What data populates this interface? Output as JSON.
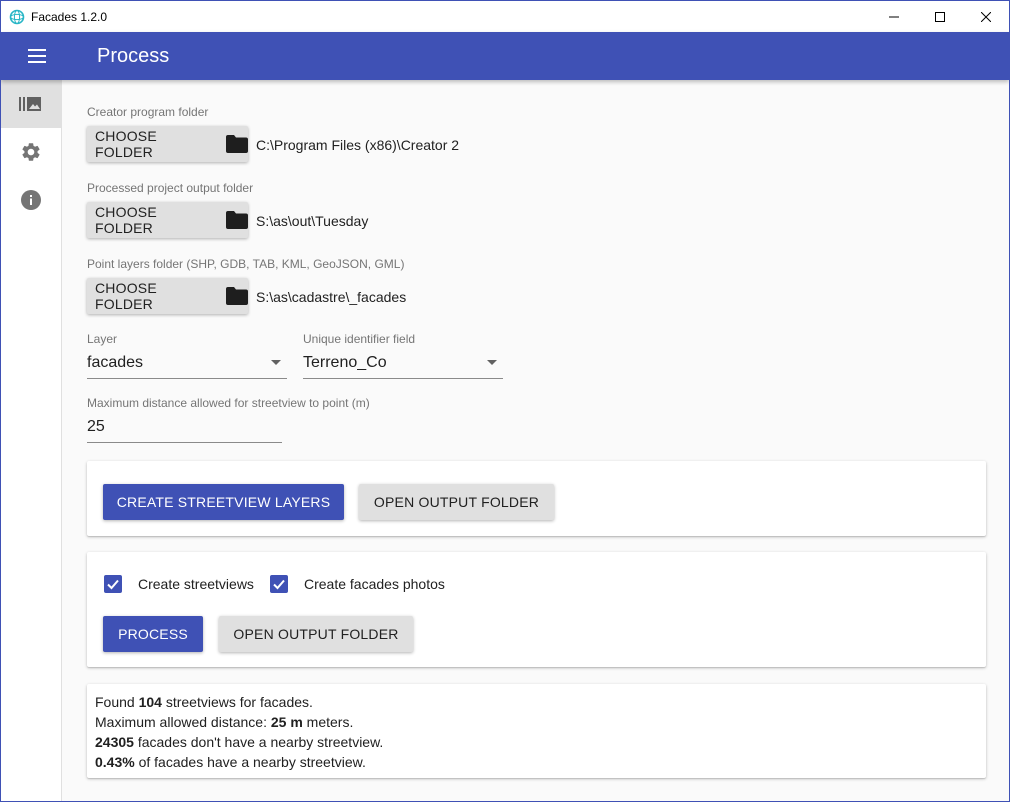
{
  "window": {
    "title": "Facades 1.2.0"
  },
  "appbar": {
    "title": "Process",
    "color": "#3f51b5"
  },
  "sidebar": {
    "items": [
      {
        "icon": "photo-library-icon",
        "active": true
      },
      {
        "icon": "gear-icon",
        "active": false
      },
      {
        "icon": "info-icon",
        "active": false
      }
    ]
  },
  "creator_folder": {
    "label": "Creator program folder",
    "button_label": "CHOOSE FOLDER",
    "path": "C:\\Program Files (x86)\\Creator 2"
  },
  "output_folder": {
    "label": "Processed project output folder",
    "button_label": "CHOOSE FOLDER",
    "path": "S:\\as\\out\\Tuesday"
  },
  "point_layers_folder": {
    "label": "Point layers folder (SHP, GDB, TAB, KML, GeoJSON, GML)",
    "button_label": "CHOOSE FOLDER",
    "path": "S:\\as\\cadastre\\_facades"
  },
  "layer": {
    "label": "Layer",
    "value": "facades"
  },
  "unique_id_field": {
    "label": "Unique identifier field",
    "value": "Terreno_Co"
  },
  "max_distance": {
    "label": "Maximum distance allowed for streetview to point (m)",
    "value": "25"
  },
  "streetview_card": {
    "create_button": "CREATE STREETVIEW LAYERS",
    "open_button": "OPEN OUTPUT FOLDER"
  },
  "process_card": {
    "checkbox_streetviews": {
      "label": "Create streetviews",
      "checked": true
    },
    "checkbox_facades": {
      "label": "Create facades photos",
      "checked": true
    },
    "process_button": "PROCESS",
    "open_button": "OPEN OUTPUT FOLDER"
  },
  "results": {
    "line1_pre": "Found ",
    "line1_bold": "104",
    "line1_post": " streetviews for facades.",
    "line2_pre": "Maximum allowed distance: ",
    "line2_bold": "25 m",
    "line2_post": " meters.",
    "line3_bold": "24305",
    "line3_post": " facades don't have a nearby streetview.",
    "line4_bold": "0.43%",
    "line4_post": " of facades have a nearby streetview."
  }
}
